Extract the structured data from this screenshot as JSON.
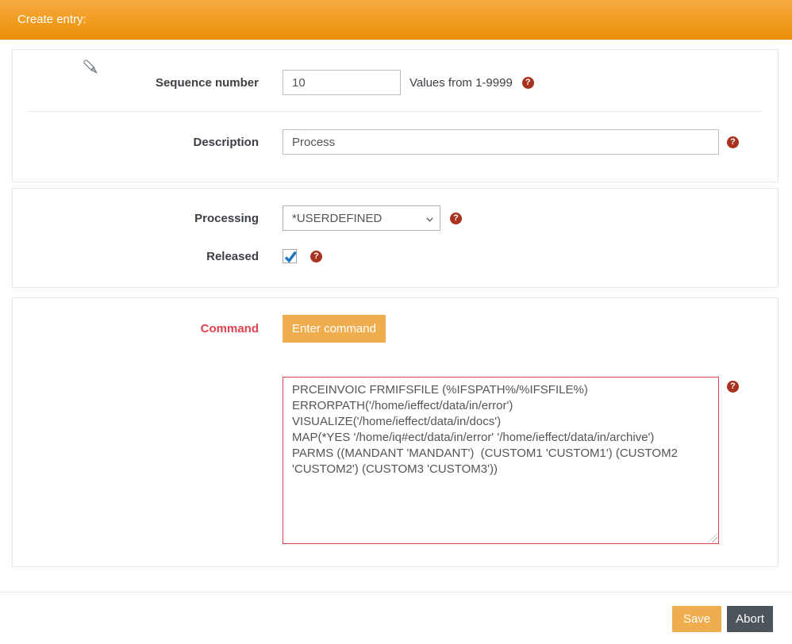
{
  "header": {
    "title": "Create entry:"
  },
  "form": {
    "sequence": {
      "label": "Sequence number",
      "value": "10",
      "hint": "Values from 1-9999"
    },
    "description": {
      "label": "Description",
      "value": "Process"
    },
    "processing": {
      "label": "Processing",
      "selected": "*USERDEFINED"
    },
    "released": {
      "label": "Released",
      "checked": true
    },
    "command": {
      "label": "Command",
      "button_label": "Enter command",
      "value": "PRCEINVOIC FRMIFSFILE (%IFSPATH%/%IFSFILE%)\nERRORPATH('/home/ieffect/data/in/error')\nVISUALIZE('/home/ieffect/data/in/docs')\nMAP(*YES '/home/iq#ect/data/in/error' '/home/ieffect/data/in/archive')\nPARMS ((MANDANT 'MANDANT')  (CUSTOM1 'CUSTOM1') (CUSTOM2 'CUSTOM2') (CUSTOM3 'CUSTOM3'))"
    }
  },
  "footer": {
    "save_label": "Save",
    "abort_label": "Abort"
  },
  "icons": {
    "help_glyph": "?"
  },
  "colors": {
    "header_orange_top": "#f6ab41",
    "header_orange_bottom": "#e98d06",
    "button_orange": "#f0ad4e",
    "abort_gray": "#4c545c",
    "danger_red": "#e2414f",
    "help_icon_red": "#a93120",
    "checkbox_blue": "#1d76bb"
  }
}
